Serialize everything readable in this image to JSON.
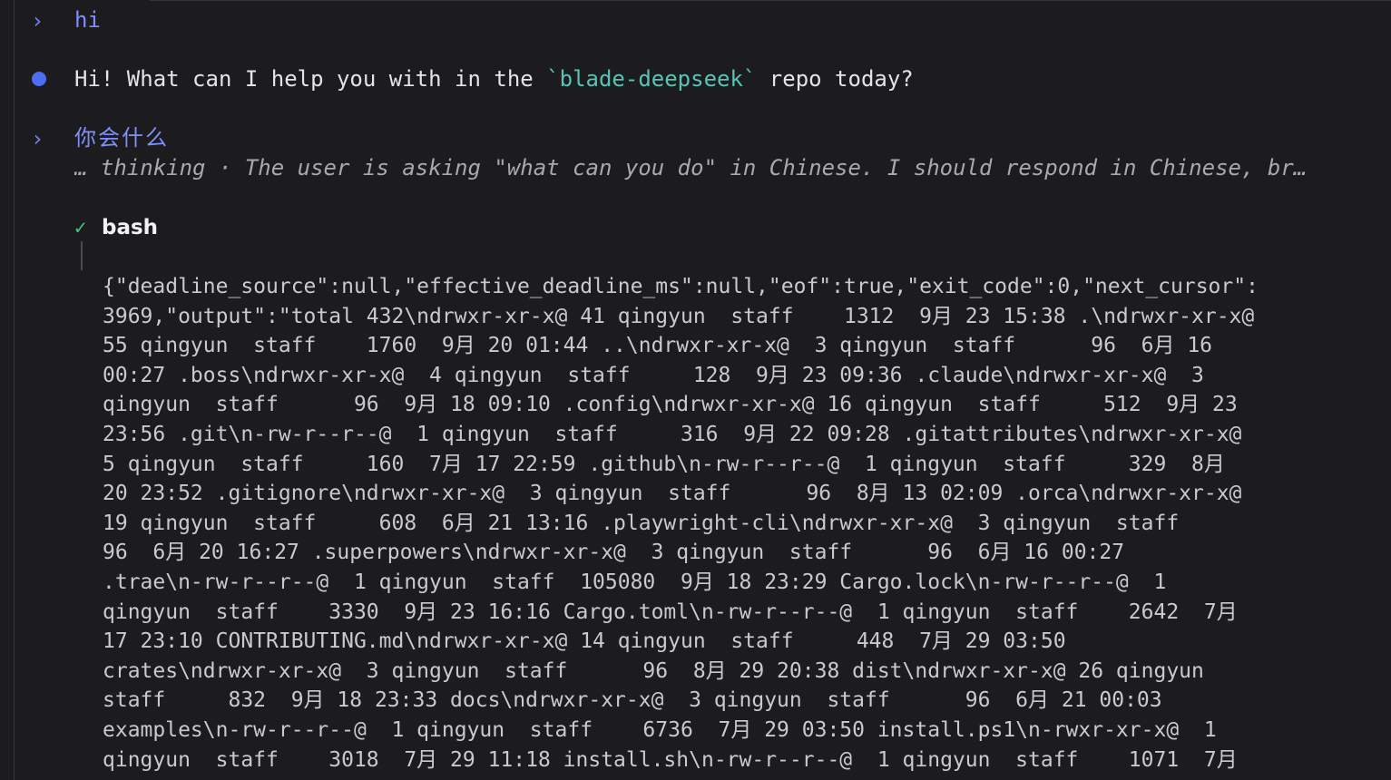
{
  "conversation": {
    "turn1_prompt_marker": "›",
    "turn1_user_message": "hi",
    "assistant_reply_before": "Hi! What can I help you with in the ",
    "assistant_reply_code": "`blade-deepseek`",
    "assistant_reply_after": " repo today?",
    "turn2_prompt_marker": "›",
    "turn2_user_message": "你会什么",
    "thinking_summary": "… thinking · The user is asking \"what can you do\" in Chinese. I should respond in Chinese, br…"
  },
  "tool_call": {
    "status_icon": "check-icon",
    "status_glyph": "✓",
    "status_color": "#4cc38a",
    "name": "bash",
    "output_lines": [
      "{\"deadline_source\":null,\"effective_deadline_ms\":null,\"eof\":true,\"exit_code\":0,\"next_cursor\":",
      "3969,\"output\":\"total 432\\ndrwxr-xr-x@ 41 qingyun  staff    1312  9月 23 15:38 .\\ndrwxr-xr-x@",
      "55 qingyun  staff    1760  9月 20 01:44 ..\\ndrwxr-xr-x@  3 qingyun  staff      96  6月 16",
      "00:27 .boss\\ndrwxr-xr-x@  4 qingyun  staff     128  9月 23 09:36 .claude\\ndrwxr-xr-x@  3",
      "qingyun  staff      96  9月 18 09:10 .config\\ndrwxr-xr-x@ 16 qingyun  staff     512  9月 23",
      "23:56 .git\\n-rw-r--r--@  1 qingyun  staff     316  9月 22 09:28 .gitattributes\\ndrwxr-xr-x@",
      "5 qingyun  staff     160  7月 17 22:59 .github\\n-rw-r--r--@  1 qingyun  staff     329  8月",
      "20 23:52 .gitignore\\ndrwxr-xr-x@  3 qingyun  staff      96  8月 13 02:09 .orca\\ndrwxr-xr-x@",
      "19 qingyun  staff     608  6月 21 13:16 .playwright-cli\\ndrwxr-xr-x@  3 qingyun  staff",
      "96  6月 20 16:27 .superpowers\\ndrwxr-xr-x@  3 qingyun  staff      96  6月 16 00:27",
      ".trae\\n-rw-r--r--@  1 qingyun  staff  105080  9月 18 23:29 Cargo.lock\\n-rw-r--r--@  1",
      "qingyun  staff    3330  9月 23 16:16 Cargo.toml\\n-rw-r--r--@  1 qingyun  staff    2642  7月",
      "17 23:10 CONTRIBUTING.md\\ndrwxr-xr-x@ 14 qingyun  staff     448  7月 29 03:50",
      "crates\\ndrwxr-xr-x@  3 qingyun  staff      96  8月 29 20:38 dist\\ndrwxr-xr-x@ 26 qingyun",
      "staff     832  9月 18 23:33 docs\\ndrwxr-xr-x@  3 qingyun  staff      96  6月 21 00:03",
      "examples\\n-rw-r--r--@  1 qingyun  staff    6736  7月 29 03:50 install.ps1\\n-rwxr-xr-x@  1",
      "qingyun  staff    3018  7月 29 11:18 install.sh\\n-rw-r--r--@  1 qingyun  staff    1071  7月"
    ]
  },
  "colors": {
    "background": "#1c1c1e",
    "user_accent": "#7f8ffc",
    "assistant_bullet": "#4d6df2",
    "code_highlight": "#56c4b6"
  }
}
